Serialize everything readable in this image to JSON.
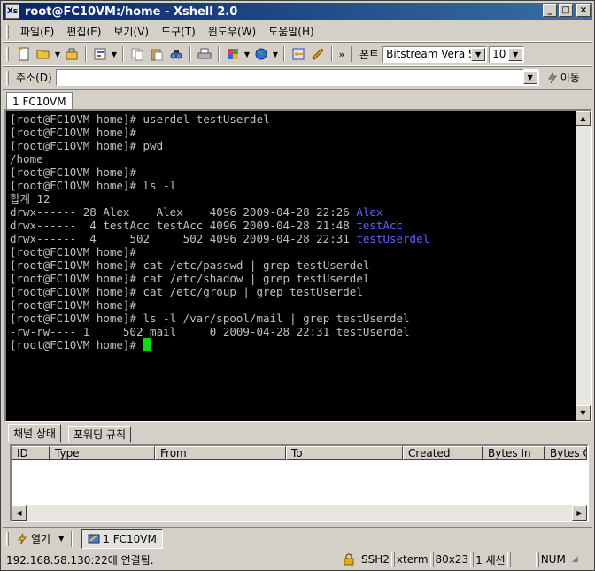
{
  "window": {
    "title": "root@FC10VM:/home - Xshell 2.0",
    "app_icon": "Xs"
  },
  "menu": [
    "파일(F)",
    "편집(E)",
    "보기(V)",
    "도구(T)",
    "윈도우(W)",
    "도움말(H)"
  ],
  "toolbar": {
    "font_label": "폰트",
    "font_value": "Bitstream Vera S:",
    "size_value": "10",
    "more": "»"
  },
  "address": {
    "label": "주소(D)",
    "value": "",
    "go_label": "이동"
  },
  "session_tab": "1 FC10VM",
  "terminal": {
    "lines": [
      [
        {
          "t": "[root@FC10VM home]# userdel testUserdel"
        }
      ],
      [
        {
          "t": "[root@FC10VM home]#"
        }
      ],
      [
        {
          "t": "[root@FC10VM home]# pwd"
        }
      ],
      [
        {
          "t": "/home"
        }
      ],
      [
        {
          "t": "[root@FC10VM home]#"
        }
      ],
      [
        {
          "t": "[root@FC10VM home]# ls -l"
        }
      ],
      [
        {
          "t": "합계 12"
        }
      ],
      [
        {
          "t": "drwx------ 28 Alex    Alex    4096 2009-04-28 22:26 "
        },
        {
          "t": "Alex",
          "c": "blue"
        }
      ],
      [
        {
          "t": "drwx------  4 testAcc testAcc 4096 2009-04-28 21:48 "
        },
        {
          "t": "testAcc",
          "c": "blue"
        }
      ],
      [
        {
          "t": "drwx------  4     502     502 4096 2009-04-28 22:31 "
        },
        {
          "t": "testUserdel",
          "c": "blue"
        }
      ],
      [
        {
          "t": "[root@FC10VM home]#"
        }
      ],
      [
        {
          "t": "[root@FC10VM home]# cat /etc/passwd | grep testUserdel"
        }
      ],
      [
        {
          "t": "[root@FC10VM home]# cat /etc/shadow | grep testUserdel"
        }
      ],
      [
        {
          "t": "[root@FC10VM home]# cat /etc/group | grep testUserdel"
        }
      ],
      [
        {
          "t": "[root@FC10VM home]#"
        }
      ],
      [
        {
          "t": "[root@FC10VM home]# ls -l /var/spool/mail | grep testUserdel"
        }
      ],
      [
        {
          "t": "-rw-rw---- 1     502 mail     0 2009-04-28 22:31 testUserdel"
        }
      ],
      [
        {
          "t": "[root@FC10VM home]# "
        },
        {
          "t": "",
          "c": "cursor"
        }
      ]
    ]
  },
  "panel": {
    "tabs": [
      "채널 상태",
      "포워딩 규칙"
    ],
    "columns": [
      "ID",
      "Type",
      "From",
      "To",
      "Created",
      "Bytes In",
      "Bytes Out"
    ]
  },
  "bottombar": {
    "open_label": "열기",
    "task_label": "1 FC10VM"
  },
  "status": {
    "message": "192.168.58.130:22에 연결됨.",
    "protocol": "SSH2",
    "terminal_type": "xterm",
    "size": "80x23",
    "sessions": "1 세션",
    "num": "NUM"
  }
}
